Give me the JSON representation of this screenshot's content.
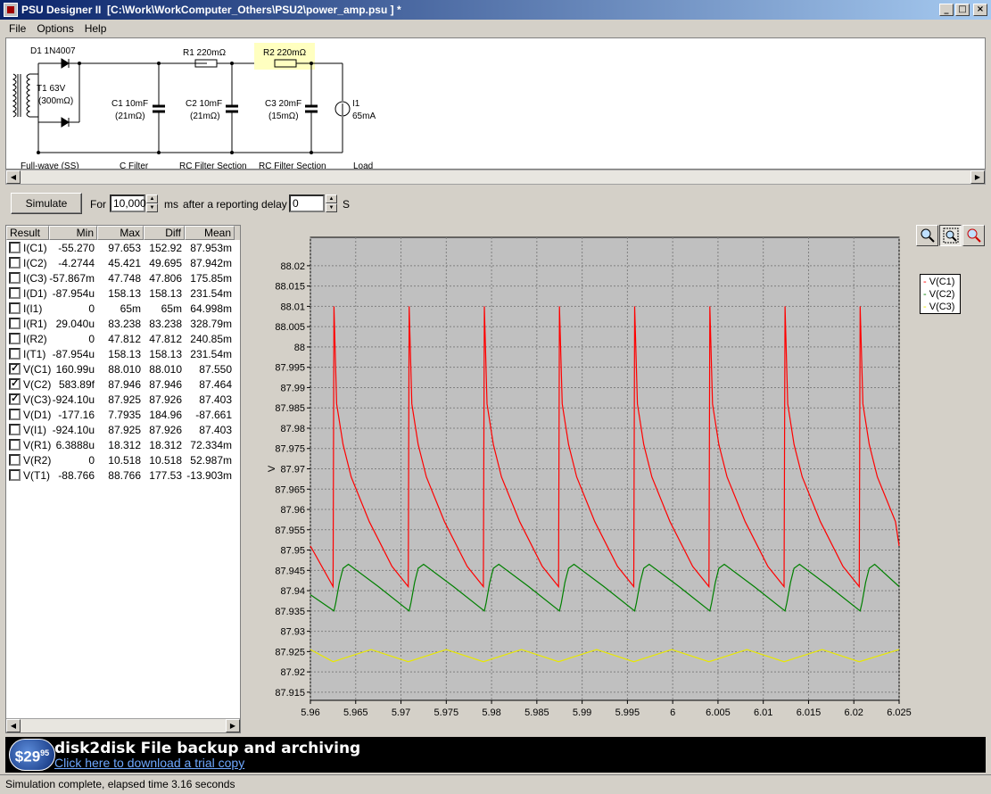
{
  "window": {
    "title": "PSU Designer II  [C:\\Work\\WorkComputer_Others\\PSU2\\power_amp.psu ] *",
    "buttons": {
      "minimize": "_",
      "maximize": "□",
      "close": "×"
    }
  },
  "menu": [
    "File",
    "Options",
    "Help"
  ],
  "schematic": {
    "d1": "D1 1N4007",
    "t1_name": "T1 63V",
    "t1_res": "(300mΩ)",
    "r1": "R1 220mΩ",
    "r2": "R2 220mΩ",
    "c1_val": "C1 10mF",
    "c1_res": "(21mΩ)",
    "c2_val": "C2 10mF",
    "c2_res": "(21mΩ)",
    "c3_val": "C3 20mF",
    "c3_res": "(15mΩ)",
    "i1_name": "I1",
    "i1_val": "65mA",
    "sections": [
      "Full-wave (SS)",
      "C Filter",
      "RC Filter Section",
      "RC Filter Section",
      "Load"
    ]
  },
  "sim": {
    "button": "Simulate",
    "for_label": "For",
    "duration": "10,000",
    "ms_label": "ms",
    "delay_label": "after a reporting delay of",
    "delay": "0",
    "s_label": "S"
  },
  "results": {
    "headers": [
      "Result",
      "Min",
      "Max",
      "Diff",
      "Mean"
    ],
    "rows": [
      {
        "name": "I(C1)",
        "checked": false,
        "min": "-55.270",
        "max": "97.653",
        "diff": "152.92",
        "mean": "87.953m"
      },
      {
        "name": "I(C2)",
        "checked": false,
        "min": "-4.2744",
        "max": "45.421",
        "diff": "49.695",
        "mean": "87.942m"
      },
      {
        "name": "I(C3)",
        "checked": false,
        "min": "-57.867m",
        "max": "47.748",
        "diff": "47.806",
        "mean": "175.85m"
      },
      {
        "name": "I(D1)",
        "checked": false,
        "min": "-87.954u",
        "max": "158.13",
        "diff": "158.13",
        "mean": "231.54m"
      },
      {
        "name": "I(I1)",
        "checked": false,
        "min": "0",
        "max": "65m",
        "diff": "65m",
        "mean": "64.998m"
      },
      {
        "name": "I(R1)",
        "checked": false,
        "min": "29.040u",
        "max": "83.238",
        "diff": "83.238",
        "mean": "328.79m"
      },
      {
        "name": "I(R2)",
        "checked": false,
        "min": "0",
        "max": "47.812",
        "diff": "47.812",
        "mean": "240.85m"
      },
      {
        "name": "I(T1)",
        "checked": false,
        "min": "-87.954u",
        "max": "158.13",
        "diff": "158.13",
        "mean": "231.54m"
      },
      {
        "name": "V(C1)",
        "checked": true,
        "min": "160.99u",
        "max": "88.010",
        "diff": "88.010",
        "mean": "87.550"
      },
      {
        "name": "V(C2)",
        "checked": true,
        "min": "583.89f",
        "max": "87.946",
        "diff": "87.946",
        "mean": "87.464"
      },
      {
        "name": "V(C3)",
        "checked": true,
        "min": "-924.10u",
        "max": "87.925",
        "diff": "87.926",
        "mean": "87.403"
      },
      {
        "name": "V(D1)",
        "checked": false,
        "min": "-177.16",
        "max": "7.7935",
        "diff": "184.96",
        "mean": "-87.661"
      },
      {
        "name": "V(I1)",
        "checked": false,
        "min": "-924.10u",
        "max": "87.925",
        "diff": "87.926",
        "mean": "87.403"
      },
      {
        "name": "V(R1)",
        "checked": false,
        "min": "6.3888u",
        "max": "18.312",
        "diff": "18.312",
        "mean": "72.334m"
      },
      {
        "name": "V(R2)",
        "checked": false,
        "min": "0",
        "max": "10.518",
        "diff": "10.518",
        "mean": "52.987m"
      },
      {
        "name": "V(T1)",
        "checked": false,
        "min": "-88.766",
        "max": "88.766",
        "diff": "177.53",
        "mean": "-13.903m"
      }
    ]
  },
  "chart_data": {
    "type": "line",
    "ylabel": "V",
    "xlabel": "",
    "xlim": [
      5.96,
      6.025
    ],
    "ylim": [
      87.913,
      88.027
    ],
    "xticks": [
      "5.96",
      "5.965",
      "5.97",
      "5.975",
      "5.98",
      "5.985",
      "5.99",
      "5.995",
      "6",
      "6.005",
      "6.01",
      "6.015",
      "6.02",
      "6.025"
    ],
    "yticks": [
      "88.02",
      "88.015",
      "88.01",
      "88.005",
      "88",
      "87.995",
      "87.99",
      "87.985",
      "87.98",
      "87.975",
      "87.97",
      "87.965",
      "87.96",
      "87.955",
      "87.95",
      "87.945",
      "87.94",
      "87.935",
      "87.93",
      "87.925",
      "87.92",
      "87.915"
    ],
    "grid": true,
    "legend_position": "right",
    "series": [
      {
        "name": "V(C1)",
        "color": "#ff0000",
        "x": [
          5.96,
          5.9625,
          5.9626,
          5.9629,
          5.9636,
          5.9645,
          5.9665,
          5.969,
          5.9708,
          5.9709,
          5.9712,
          5.9719,
          5.9728,
          5.9748,
          5.9773,
          5.9791,
          5.9792,
          5.9795,
          5.9802,
          5.9811,
          5.9831,
          5.9856,
          5.9874,
          5.9875,
          5.9878,
          5.9885,
          5.9894,
          5.9914,
          5.9939,
          5.9957,
          5.9958,
          5.9961,
          5.9968,
          5.9977,
          5.9997,
          6.0022,
          6.004,
          6.0041,
          6.0044,
          6.0051,
          6.006,
          6.008,
          6.0105,
          6.0123,
          6.0124,
          6.0127,
          6.0134,
          6.0143,
          6.0163,
          6.0188,
          6.0206,
          6.0207,
          6.021,
          6.0217,
          6.0226,
          6.0246,
          6.025
        ],
        "y": [
          87.951,
          87.941,
          88.01,
          87.986,
          87.976,
          87.968,
          87.957,
          87.946,
          87.941,
          88.01,
          87.986,
          87.976,
          87.968,
          87.957,
          87.946,
          87.941,
          88.01,
          87.986,
          87.976,
          87.968,
          87.957,
          87.946,
          87.941,
          88.01,
          87.986,
          87.976,
          87.968,
          87.957,
          87.946,
          87.941,
          88.01,
          87.986,
          87.976,
          87.968,
          87.957,
          87.946,
          87.941,
          88.01,
          87.986,
          87.976,
          87.968,
          87.957,
          87.946,
          87.941,
          88.01,
          87.986,
          87.976,
          87.968,
          87.957,
          87.946,
          87.941,
          88.01,
          87.986,
          87.976,
          87.968,
          87.957,
          87.951
        ]
      },
      {
        "name": "V(C2)",
        "color": "#008000",
        "x": [
          5.96,
          5.9626,
          5.9628,
          5.9632,
          5.9636,
          5.9642,
          5.9675,
          5.9709,
          5.9711,
          5.9715,
          5.9719,
          5.9725,
          5.9758,
          5.9792,
          5.9794,
          5.9798,
          5.9802,
          5.9808,
          5.9841,
          5.9875,
          5.9877,
          5.9881,
          5.9885,
          5.9891,
          5.9924,
          5.9958,
          5.996,
          5.9964,
          5.9968,
          5.9974,
          6.0007,
          6.0041,
          6.0043,
          6.0047,
          6.0051,
          6.0057,
          6.009,
          6.0124,
          6.0126,
          6.013,
          6.0134,
          6.014,
          6.0173,
          6.0207,
          6.0209,
          6.0213,
          6.0217,
          6.0223,
          6.025
        ],
        "y": [
          87.939,
          87.935,
          87.937,
          87.942,
          87.9455,
          87.9465,
          87.941,
          87.935,
          87.937,
          87.942,
          87.9455,
          87.9465,
          87.941,
          87.935,
          87.937,
          87.942,
          87.9455,
          87.9465,
          87.941,
          87.935,
          87.937,
          87.942,
          87.9455,
          87.9465,
          87.941,
          87.935,
          87.937,
          87.942,
          87.9455,
          87.9465,
          87.941,
          87.935,
          87.937,
          87.942,
          87.9455,
          87.9465,
          87.941,
          87.935,
          87.937,
          87.942,
          87.9455,
          87.9465,
          87.941,
          87.935,
          87.937,
          87.942,
          87.9455,
          87.9465,
          87.941
        ]
      },
      {
        "name": "V(C3)",
        "color": "#e8e800",
        "x": [
          5.96,
          5.9625,
          5.9667,
          5.9708,
          5.975,
          5.9791,
          5.9833,
          5.9874,
          5.9916,
          5.9957,
          5.9999,
          6.004,
          6.0082,
          6.0123,
          6.0165,
          6.0206,
          6.025
        ],
        "y": [
          87.9255,
          87.9225,
          87.9255,
          87.9225,
          87.9255,
          87.9225,
          87.9255,
          87.9225,
          87.9255,
          87.9225,
          87.9255,
          87.9225,
          87.9255,
          87.9225,
          87.9255,
          87.9225,
          87.9255
        ]
      }
    ]
  },
  "banner": {
    "price": "$29",
    "price_cents": "95",
    "title": "disk2disk File backup and archiving",
    "link": "Click here to download a trial copy"
  },
  "status": "Simulation complete, elapsed time 3.16 seconds"
}
